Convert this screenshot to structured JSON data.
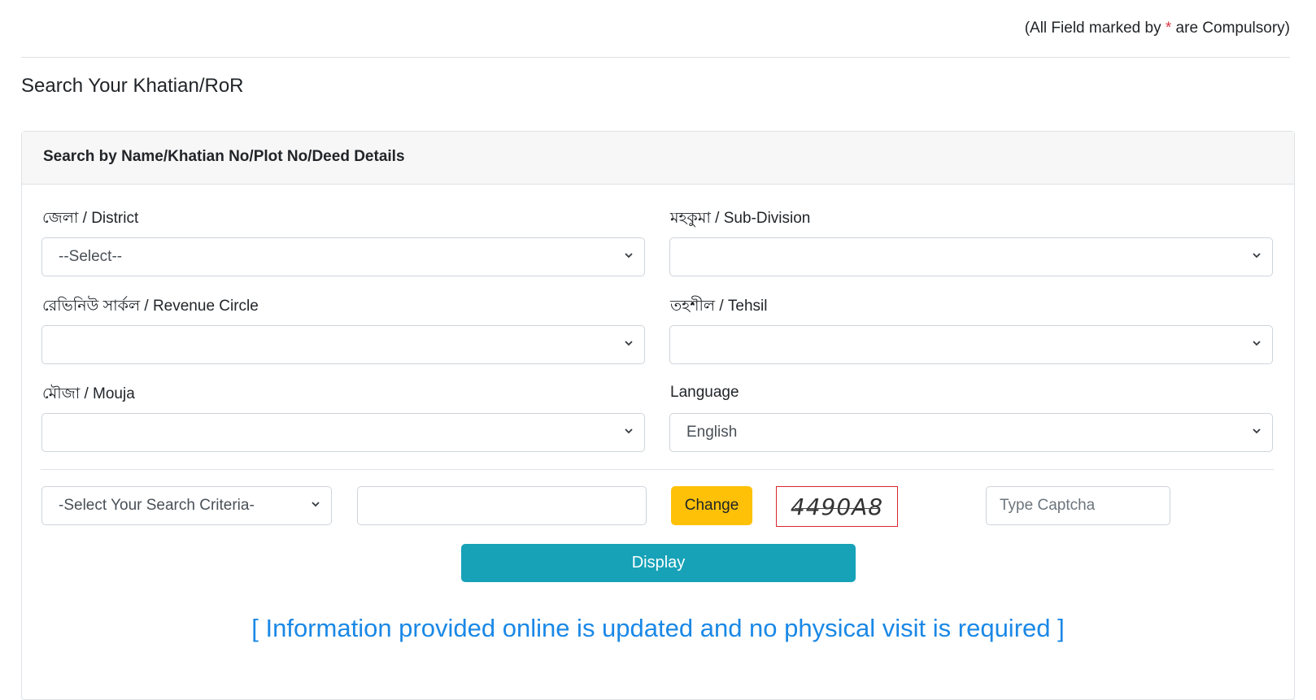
{
  "header": {
    "note_prefix": "(All Field marked by ",
    "note_star": "*",
    "note_suffix": " are Compulsory)",
    "title": "Search Your Khatian/RoR"
  },
  "card": {
    "title": "Search by Name/Khatian No/Plot No/Deed Details"
  },
  "fields": {
    "district": {
      "label": "জেলা / District",
      "value": "--Select--"
    },
    "subdivision": {
      "label": "মহকুমা / Sub-Division",
      "value": ""
    },
    "revenue_circle": {
      "label": "রেভিনিউ সার্কল / Revenue Circle",
      "value": ""
    },
    "tehsil": {
      "label": "তহশীল / Tehsil",
      "value": ""
    },
    "mouja": {
      "label": "মৌজা / Mouja",
      "value": ""
    },
    "language": {
      "label": "Language",
      "value": "English"
    }
  },
  "search": {
    "criteria_value": "-Select Your Search Criteria-",
    "query_value": "",
    "change_label": "Change",
    "captcha_text": "4490A8",
    "captcha_placeholder": "Type Captcha",
    "display_label": "Display"
  },
  "info_text": "[ Information provided online is updated and no physical visit is required ]",
  "colors": {
    "change_button": "#ffc107",
    "display_button": "#17a2b8",
    "info_text": "#1a88e6",
    "required_star": "#dc3545",
    "captcha_border": "#d9272e"
  },
  "icons": {
    "select_caret": "chevron-down-icon"
  }
}
